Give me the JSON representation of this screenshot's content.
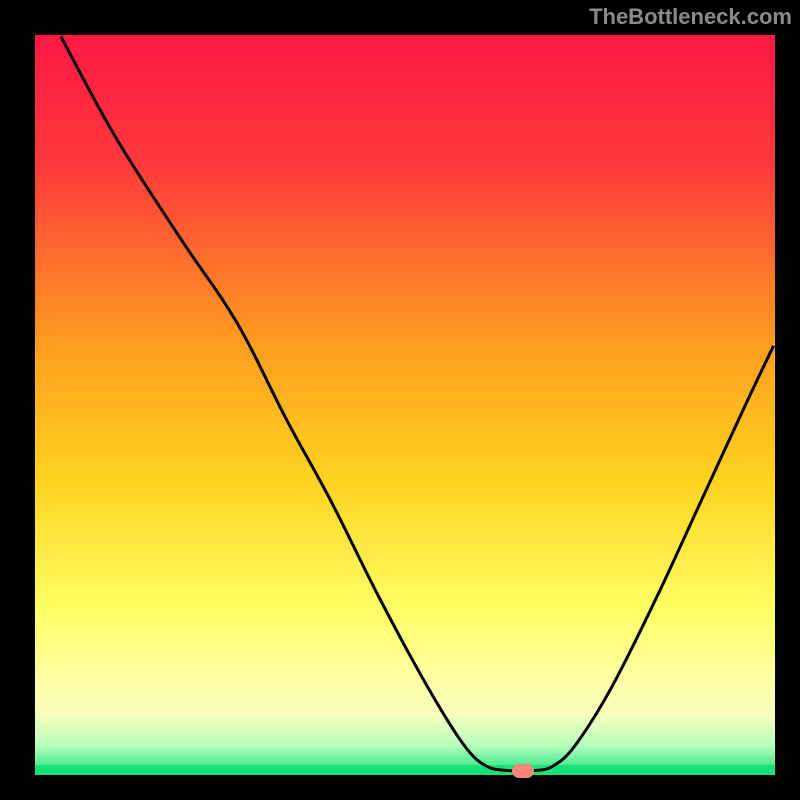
{
  "watermark": "TheBottleneck.com",
  "chart_data": {
    "type": "line",
    "title": "",
    "xlabel": "",
    "ylabel": "",
    "xlim": [
      0,
      100
    ],
    "ylim": [
      0,
      100
    ],
    "grid": false,
    "legend": false,
    "gradient_stops": [
      {
        "pos": 0.0,
        "color": "#ff1744"
      },
      {
        "pos": 0.18,
        "color": "#ff3b3b"
      },
      {
        "pos": 0.42,
        "color": "#ff9e1f"
      },
      {
        "pos": 0.6,
        "color": "#ffd21f"
      },
      {
        "pos": 0.78,
        "color": "#ffff66"
      },
      {
        "pos": 0.88,
        "color": "#ffffaa"
      },
      {
        "pos": 0.92,
        "color": "#f5ffbd"
      },
      {
        "pos": 0.96,
        "color": "#b7ffbd"
      },
      {
        "pos": 1.0,
        "color": "#18e07a"
      }
    ],
    "baseline": {
      "y": 0,
      "color": "#18e07a"
    },
    "curve": [
      {
        "x": 3.5,
        "y": 99.8
      },
      {
        "x": 11.0,
        "y": 86.0
      },
      {
        "x": 20.0,
        "y": 72.0
      },
      {
        "x": 25.5,
        "y": 64.0
      },
      {
        "x": 29.0,
        "y": 58.0
      },
      {
        "x": 34.0,
        "y": 48.0
      },
      {
        "x": 40.0,
        "y": 37.0
      },
      {
        "x": 46.5,
        "y": 24.0
      },
      {
        "x": 53.0,
        "y": 12.0
      },
      {
        "x": 58.0,
        "y": 4.0
      },
      {
        "x": 61.0,
        "y": 1.2
      },
      {
        "x": 64.0,
        "y": 0.6
      },
      {
        "x": 67.5,
        "y": 0.6
      },
      {
        "x": 70.0,
        "y": 1.2
      },
      {
        "x": 73.0,
        "y": 4.0
      },
      {
        "x": 78.0,
        "y": 12.0
      },
      {
        "x": 84.0,
        "y": 24.0
      },
      {
        "x": 90.0,
        "y": 37.0
      },
      {
        "x": 96.0,
        "y": 50.0
      },
      {
        "x": 99.8,
        "y": 58.0
      }
    ],
    "marker": {
      "x": 66.0,
      "y": 0.6,
      "color": "#f6877a"
    }
  }
}
